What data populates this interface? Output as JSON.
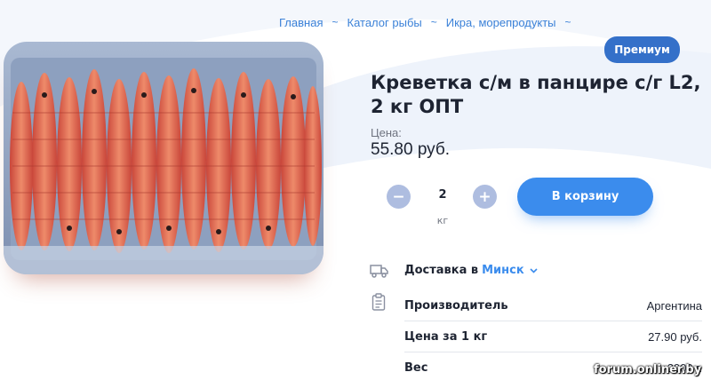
{
  "breadcrumb": {
    "items": [
      "Главная",
      "Каталог рыбы",
      "Икра, морепродукты"
    ],
    "separator": "~"
  },
  "product": {
    "image_icon": "shrimp-box-photo",
    "badge": "Премиум",
    "title": "Креветка с/м в панцире с/г L2, 2 кг ОПТ",
    "price_label": "Цена:",
    "price": "55.80 руб."
  },
  "quantity": {
    "minus": "−",
    "value": "2",
    "plus": "+",
    "unit": "кг"
  },
  "cart": {
    "label": "В корзину"
  },
  "delivery": {
    "icon": "truck-icon",
    "prefix": "Доставка в",
    "city": "Минск"
  },
  "specs": {
    "icon": "clipboard-icon",
    "rows": [
      {
        "name": "Производитель",
        "value": "Аргентина"
      },
      {
        "name": "Цена за 1 кг",
        "value": "27.90 руб."
      },
      {
        "name": "Вес",
        "value": "2000 г."
      }
    ]
  },
  "watermark": "forum.onliner.by",
  "colors": {
    "accent": "#3b8ced",
    "link": "#3c82d8",
    "badge": "#3470c9",
    "qty_button": "#aebde0",
    "background_shape": "#edf2fa"
  }
}
